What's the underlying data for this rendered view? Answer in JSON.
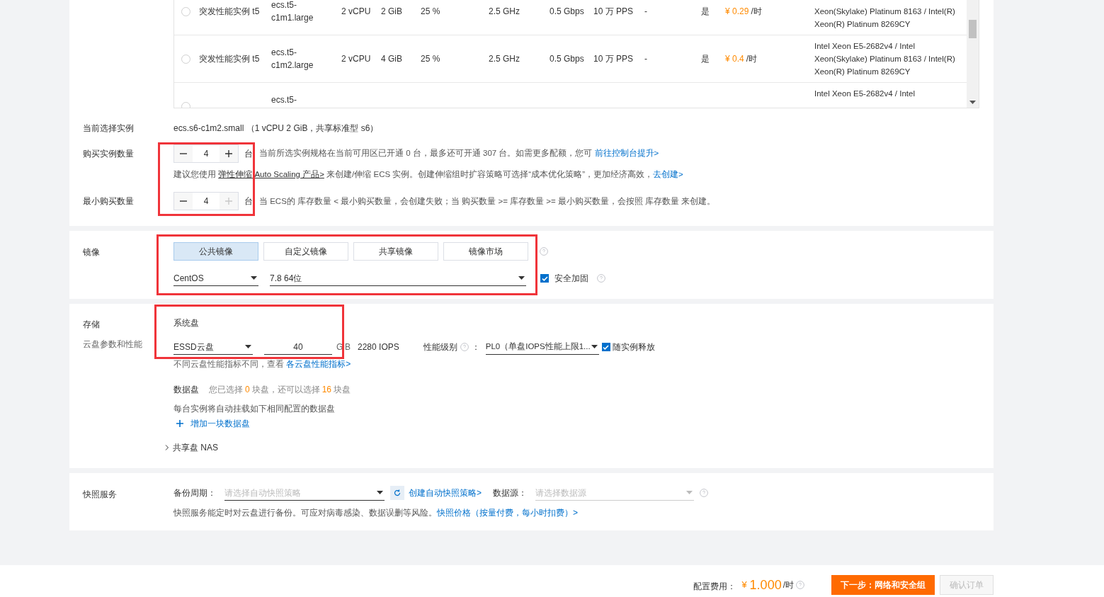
{
  "table": {
    "rows": [
      {
        "selected": false,
        "type": "突发性能实例 t5",
        "spec": "ecs.t5-c1m1.large",
        "vcpu": "2 vCPU",
        "memory": "2 GiB",
        "baseline": "25 %",
        "clock": "2.5 GHz",
        "bandwidth": "0.5 Gbps",
        "pps": "10 万 PPS",
        "column_9": "-",
        "column_10": "是",
        "price": "¥ 0.29",
        "unit": "/时",
        "cpu": "Xeon(Skylake) Platinum 8163 / Intel(R) Xeon(R) Platinum 8269CY"
      },
      {
        "selected": false,
        "type": "突发性能实例 t5",
        "spec": "ecs.t5-c1m2.large",
        "vcpu": "2 vCPU",
        "memory": "4 GiB",
        "baseline": "25 %",
        "clock": "2.5 GHz",
        "bandwidth": "0.5 Gbps",
        "pps": "10 万 PPS",
        "column_9": "-",
        "column_10": "是",
        "price": "¥ 0.4",
        "unit": "/时",
        "cpu": "Intel Xeon E5-2682v4 / Intel Xeon(Skylake) Platinum 8163 / Intel(R) Xeon(R) Platinum 8269CY"
      },
      {
        "selected": false,
        "spec": "ecs.t5-",
        "cpu": "Intel Xeon E5-2682v4 / Intel"
      }
    ]
  },
  "current": {
    "label": "当前选择实例",
    "value": "ecs.s6-c1m2.small （1 vCPU 2 GiB，共享标准型 s6）"
  },
  "quantity": {
    "label": "购买实例数量",
    "value": "4",
    "unit": "台",
    "plus_disabled": false,
    "note": "当前所选实例规格在当前可用区已开通 0 台，最多还可开通 307 台。如需更多配额，您可",
    "note_link": "前往控制台提升>",
    "suggest_pre": "建议您使用",
    "suggest_link": "弹性伸缩 Auto Scaling 产品>",
    "suggest_mid": "来创建/伸缩 ECS 实例。创建伸缩组时扩容策略可选择“成本优化策略”，更加经济高效，",
    "suggest_link2": "去创建>"
  },
  "min_quantity": {
    "label": "最小购买数量",
    "value": "4",
    "unit": "台",
    "plus_disabled": true,
    "note": "当 ECS的 库存数量 < 最小购买数量，会创建失败；当 购买数量 >= 库存数量 >= 最小购买数量，会按照 库存数量 来创建。"
  },
  "image": {
    "label": "镜像",
    "tabs": [
      {
        "label": "公共镜像",
        "selected": true
      },
      {
        "label": "自定义镜像",
        "selected": false
      },
      {
        "label": "共享镜像",
        "selected": false
      },
      {
        "label": "镜像市场",
        "selected": false
      }
    ],
    "os": "CentOS",
    "version": "7.8 64位",
    "hardening": {
      "label": "安全加固",
      "checked": true
    }
  },
  "storage": {
    "label": "存储",
    "sublabel": "云盘参数和性能",
    "system_disk": {
      "title": "系统盘",
      "type": "ESSD云盘",
      "size": "40",
      "unit": "GiB",
      "iops": "2280 IOPS",
      "perf_label": "性能级别",
      "perf_colon": "：",
      "perf_value": "PL0（单盘IOPS性能上限1...",
      "release": {
        "label": "随实例释放",
        "checked": true
      },
      "note": "不同云盘性能指标不同，查看",
      "note_link": "各云盘性能指标>"
    },
    "data_disk": {
      "title": "数据盘",
      "info": [
        {
          "kind": "plain",
          "text": "您已选择"
        },
        {
          "kind": "count",
          "text": "0"
        },
        {
          "kind": "plain",
          "text": "块盘，还可以选择"
        },
        {
          "kind": "count",
          "text": "16"
        },
        {
          "kind": "plain",
          "text": "块盘"
        }
      ],
      "auto_note": "每台实例将自动挂载如下相同配置的数据盘",
      "add": "增加一块数据盘"
    },
    "nas": {
      "label": "共享盘 NAS",
      "expanded": false
    }
  },
  "snapshot": {
    "label": "快照服务",
    "backup_label": "备份周期：",
    "backup_placeholder": "请选择自动快照策略",
    "create_link": "创建自动快照策略>",
    "source_label": "数据源：",
    "source_placeholder": "请选择数据源",
    "note": "快照服务能定时对云盘进行备份。可应对病毒感染、数据误删等风险。",
    "note_link": "快照价格（按量付费，每小时扣费）>"
  },
  "footer": {
    "cost_label": "配置费用：",
    "currency": "¥",
    "price": "1.000",
    "unit": "/时",
    "next": "下一步：网络和安全组",
    "confirm": {
      "label": "确认订单",
      "disabled": true
    }
  }
}
